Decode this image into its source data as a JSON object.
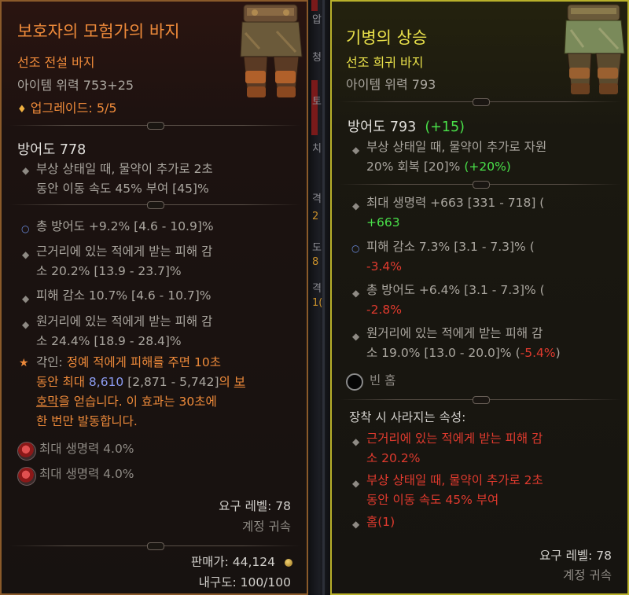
{
  "left": {
    "name": "보호자의 모험가의 바지",
    "type": "선조 전설 바지",
    "power": "아이템 위력 753+25",
    "upgrade_icon": "diamond-icon",
    "upgrade": "업그레이드: 5/5",
    "armor": "방어도 778",
    "implicit_lines": [
      "부상 상태일 때, 물약이 추가로 2초",
      "동안 이동 속도 45% 부여 [45]%"
    ],
    "affix_1": "총 방어도 +9.2% [4.6 - 10.9]%",
    "affix_2_lines": [
      "근거리에 있는 적에게 받는 피해 감",
      "소 20.2% [13.9 - 23.7]%"
    ],
    "affix_3": "피해 감소 10.7% [4.6 - 10.7]%",
    "affix_4_lines": [
      "원거리에 있는 적에게 받는 피해 감",
      "소 24.4% [18.9 - 28.4]%"
    ],
    "aspect": {
      "prefix": "각인:",
      "line1": "정예 적에게 피해를 주면 10초",
      "line2_a": "동안 최대",
      "line2_value": "8,610",
      "line2_range": "[2,871 - 5,742]",
      "line2_b": "의",
      "line2_c": "보",
      "line3_a": "호막",
      "line3_b": "을 얻습니다. 이 효과는 30초에",
      "line4": "한 번만 발동합니다."
    },
    "gem_1": "최대 생명력 4.0%",
    "gem_2": "최대 생명력 4.0%",
    "required_level": "요구 레벨: 78",
    "account_bound": "계정 귀속",
    "sell_value": "판매가: 44,124",
    "durability": "내구도: 100/100"
  },
  "right": {
    "name": "기병의 상승",
    "type": "선조 희귀 바지",
    "power": "아이템 위력 793",
    "armor": "방어도 793",
    "armor_delta": "(+15)",
    "implicit_line1": "부상 상태일 때, 물약이 추가로 자원",
    "implicit_line2": "20% 회복 [20]%",
    "implicit_delta": "(+20%)",
    "affix_1_line1": "최대 생명력 +663 [331 - 718] (",
    "affix_1_delta": "+663",
    "affix_2_line1": "피해 감소 7.3% [3.1 - 7.3]% (",
    "affix_2_delta": "-3.4%",
    "affix_3_line1": "총 방어도 +6.4% [3.1 - 7.3]% (",
    "affix_3_delta": "-2.8%",
    "affix_4_line1": "원거리에 있는 적에게 받는 피해 감",
    "affix_4_line2": "소 19.0% [13.0 - 20.0]%",
    "affix_4_delta": "-5.4%",
    "socket": "빈 홈",
    "lost_header": "장착 시 사라지는 속성:",
    "lost_1_lines": [
      "근거리에 있는 적에게 받는 피해 감",
      "소 20.2%"
    ],
    "lost_2_lines": [
      "부상 상태일 때, 물약이 추가로 2초",
      "동안 이동 속도 45% 부여"
    ],
    "lost_3": "홈(1)",
    "required_level": "요구 레벨: 78",
    "account_bound": "계정 귀속"
  },
  "between": {
    "chars": [
      "압",
      "청",
      "토",
      "치",
      "격",
      "2",
      "도",
      "8",
      "격",
      "1("
    ]
  },
  "colors": {
    "legendary": "#ee8a3a",
    "rare": "#e8e04a",
    "positive": "#49e049",
    "negative": "#e03a2e",
    "left_border": "#8a5a2a",
    "right_border": "#b9b12a"
  }
}
